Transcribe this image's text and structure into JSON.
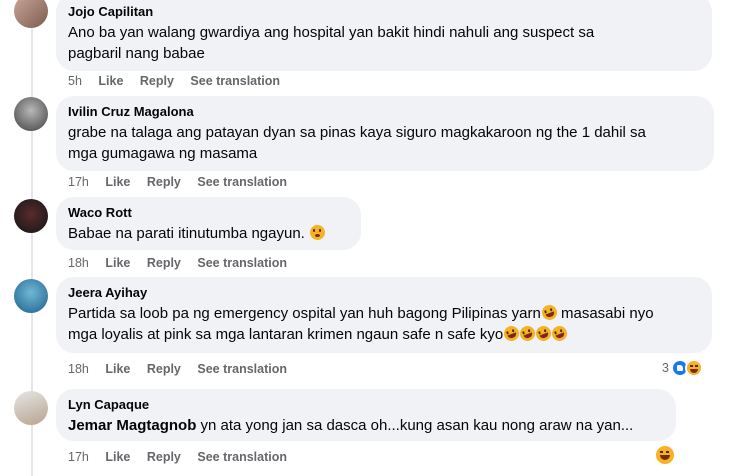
{
  "comments": [
    {
      "author": "Jojo Capilitan",
      "lines": [
        "Ano ba yan walang gwardiya ang hospital yan bakit hindi nahuli ang suspect sa",
        "pagbaril nang babae"
      ],
      "time": "5h",
      "like": "Like",
      "reply": "Reply",
      "translate": "See translation"
    },
    {
      "author": "Ivilin Cruz Magalona",
      "lines": [
        "grabe na talaga ang patayan dyan sa pinas kaya siguro magkakaroon ng the 1 dahil sa",
        "mga gumagawa ng masama"
      ],
      "time": "17h",
      "like": "Like",
      "reply": "Reply",
      "translate": "See translation"
    },
    {
      "author": "Waco Rott",
      "lines": [
        "Babae na parati itinutumba ngayun."
      ],
      "time": "18h",
      "like": "Like",
      "reply": "Reply",
      "translate": "See translation"
    },
    {
      "author": "Jeera Ayihay",
      "lines": [
        "Partida sa loob pa ng emergency ospital yan huh bagong Pilipinas yarn",
        "masasabi nyo",
        "mga loyalis at pink sa mga lantaran krimen ngaun safe n safe kyo"
      ],
      "time": "18h",
      "like": "Like",
      "reply": "Reply",
      "translate": "See translation",
      "reaction_count": "3"
    },
    {
      "author": "Lyn Capaque",
      "mention": "Jemar Magtagnob",
      "text": "yn ata yong jan sa dasca oh...kung asan kau nong araw na yan...",
      "time": "17h",
      "like": "Like",
      "reply": "Reply",
      "translate": "See translation"
    }
  ],
  "colors": {
    "bubble": "#f0f2f5",
    "meta": "#65676b",
    "like_blue": "#1877f2",
    "emoji_yellow": "#f7b125"
  },
  "icons": [
    "rofl-emoji",
    "flushed-emoji",
    "like-reaction-icon",
    "haha-reaction-icon"
  ]
}
